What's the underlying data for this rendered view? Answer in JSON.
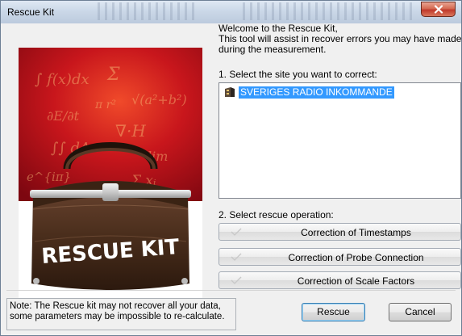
{
  "window": {
    "title": "Rescue Kit"
  },
  "artwork": {
    "caption": "RESCUE KIT"
  },
  "intro": {
    "line1": "Welcome to the Rescue Kit,",
    "line2": "This tool will assist in recover errors you may have made",
    "line3": "during the measurement."
  },
  "site_section": {
    "label": "1. Select the site you want to correct:",
    "items": [
      {
        "label": "SVERIGES RADIO INKOMMANDE",
        "icon": "station-icon",
        "selected": true
      }
    ]
  },
  "rescue_section": {
    "label": "2. Select rescue operation:",
    "operations": [
      {
        "label": "Correction of Timestamps"
      },
      {
        "label": "Correction of Probe Connection"
      },
      {
        "label": "Correction of Scale Factors"
      }
    ]
  },
  "note": {
    "text": "Note: The Rescue kit may not recover all your data, some parameters may be impossible to re-calculate."
  },
  "buttons": {
    "rescue": "Rescue",
    "cancel": "Cancel"
  },
  "colors": {
    "selection": "#3399ff",
    "close": "#c0392b",
    "bag": "#4a2e1c",
    "background_red": "#b3121b"
  }
}
